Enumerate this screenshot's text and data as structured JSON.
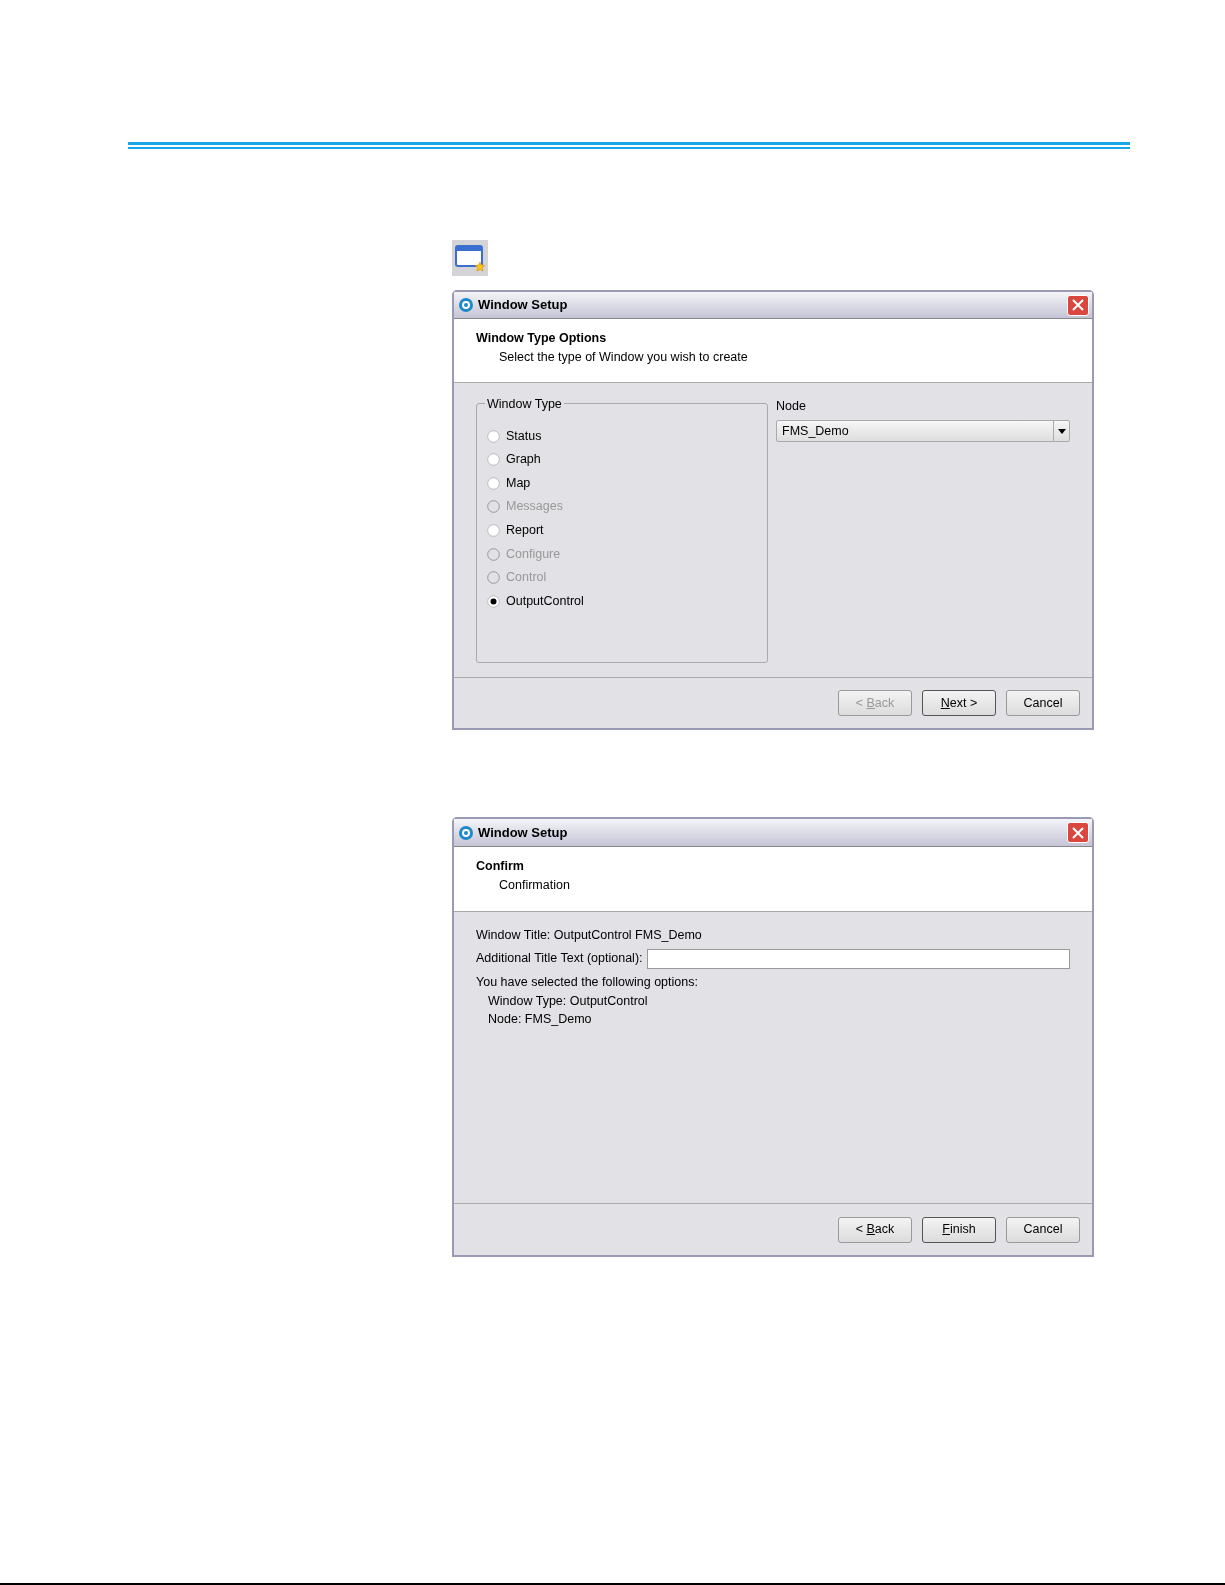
{
  "dialogs": [
    {
      "kind": "type_options",
      "title": "Window Setup",
      "header": {
        "title": "Window Type Options",
        "subtitle": "Select the type of Window you wish to create"
      },
      "group": {
        "legend": "Window Type",
        "options": [
          {
            "label": "Status",
            "selected": false,
            "disabled": false
          },
          {
            "label": "Graph",
            "selected": false,
            "disabled": false
          },
          {
            "label": "Map",
            "selected": false,
            "disabled": false
          },
          {
            "label": "Messages",
            "selected": false,
            "disabled": true
          },
          {
            "label": "Report",
            "selected": false,
            "disabled": false
          },
          {
            "label": "Configure",
            "selected": false,
            "disabled": true
          },
          {
            "label": "Control",
            "selected": false,
            "disabled": true
          },
          {
            "label": "OutputControl",
            "selected": true,
            "disabled": false
          }
        ]
      },
      "node": {
        "label": "Node",
        "value": "FMS_Demo"
      },
      "buttons": [
        {
          "label": "< ",
          "mnemonic": "B",
          "label_rest": "ack",
          "disabled": true,
          "default": false
        },
        {
          "mnemonic": "N",
          "label_rest": "ext >",
          "disabled": false,
          "default": true
        },
        {
          "label": "Cancel",
          "disabled": false,
          "default": false
        }
      ]
    },
    {
      "kind": "confirm",
      "title": "Window Setup",
      "header": {
        "title": "Confirm",
        "subtitle": "Confirmation"
      },
      "window_title": "Window Title: OutputControl FMS_Demo",
      "field": {
        "label": "Additional Title Text (optional):"
      },
      "summary": {
        "heading": "You have selected the following options:",
        "items": [
          "Window Type: OutputControl",
          "Node: FMS_Demo"
        ]
      },
      "buttons": [
        {
          "label": "< ",
          "mnemonic": "B",
          "label_rest": "ack",
          "disabled": false,
          "default": false
        },
        {
          "mnemonic": "F",
          "label_rest": "inish",
          "disabled": false,
          "default": true
        },
        {
          "label": "Cancel",
          "disabled": false,
          "default": false
        }
      ]
    }
  ]
}
